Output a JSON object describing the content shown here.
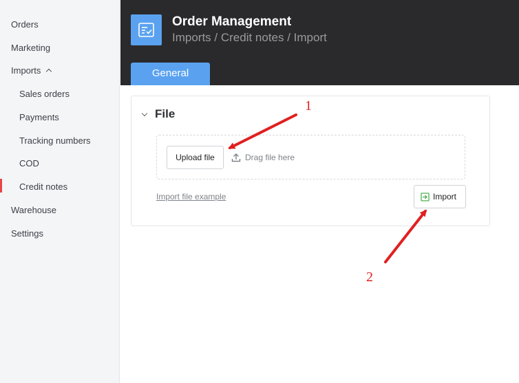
{
  "sidebar": {
    "items": [
      {
        "label": "Orders"
      },
      {
        "label": "Marketing"
      },
      {
        "label": "Imports"
      },
      {
        "label": "Sales orders"
      },
      {
        "label": "Payments"
      },
      {
        "label": "Tracking numbers"
      },
      {
        "label": "COD"
      },
      {
        "label": "Credit notes"
      },
      {
        "label": "Warehouse"
      },
      {
        "label": "Settings"
      }
    ],
    "active_item": "Credit notes",
    "active_color": "#e64646"
  },
  "header": {
    "title": "Order Management",
    "breadcrumb": "Imports / Credit notes / Import",
    "icon": "form-check-icon"
  },
  "tabs": [
    {
      "label": "General",
      "active": true
    }
  ],
  "file_section": {
    "title": "File",
    "upload_label": "Upload file",
    "drag_hint": "Drag file here",
    "example_link": "Import file example",
    "import_label": "Import"
  },
  "annotations": [
    {
      "label": "1"
    },
    {
      "label": "2"
    }
  ],
  "colors": {
    "accent": "#5aa2f0",
    "header_bg": "#2a2a2c",
    "annotation": "#e02020",
    "import_icon": "#4caf50"
  }
}
